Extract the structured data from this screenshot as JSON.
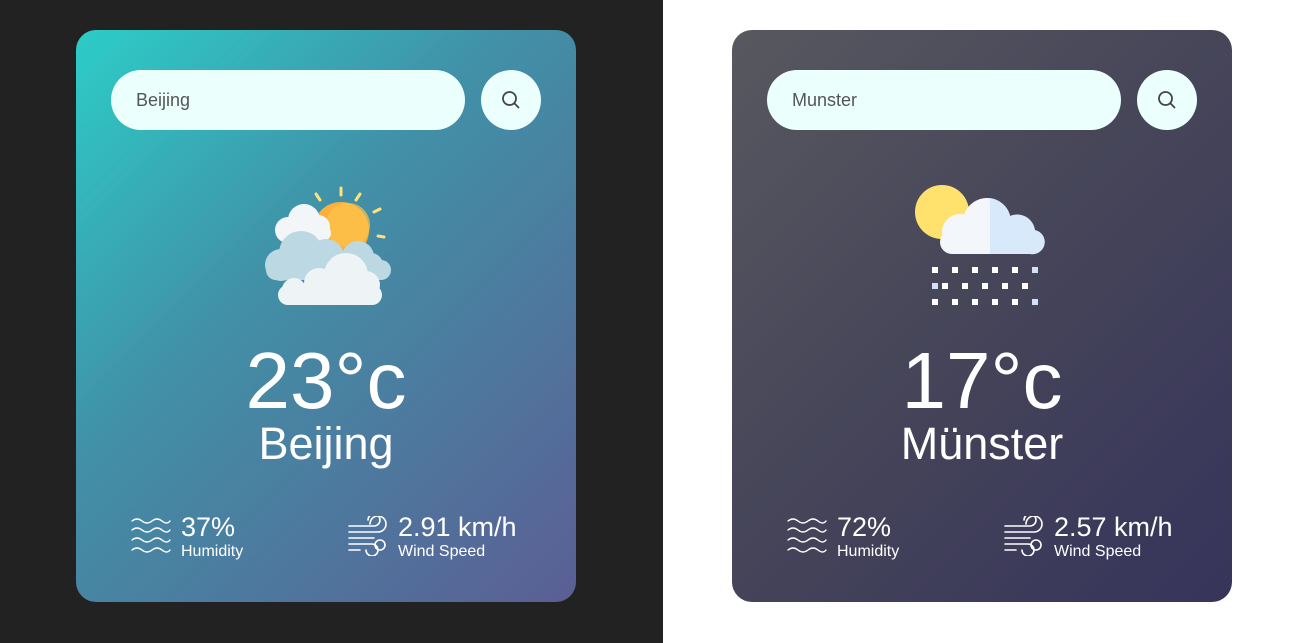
{
  "cards": [
    {
      "search": {
        "value": "Beijing"
      },
      "weather_icon": "partly-cloudy-sun-icon",
      "temperature": "23°c",
      "city": "Beijing",
      "humidity": {
        "value": "37%",
        "label": "Humidity"
      },
      "wind": {
        "value": "2.91 km/h",
        "label": "Wind Speed"
      }
    },
    {
      "search": {
        "value": "Munster"
      },
      "weather_icon": "snow-cloud-sun-icon",
      "temperature": "17°c",
      "city": "Münster",
      "humidity": {
        "value": "72%",
        "label": "Humidity"
      },
      "wind": {
        "value": "2.57 km/h",
        "label": "Wind Speed"
      }
    }
  ],
  "colors": {
    "left_background": "#222222",
    "right_background": "#ffffff",
    "card_left_gradient": [
      "#2ccdc7",
      "#5b5e94"
    ],
    "card_right_gradient": [
      "#585860",
      "#36345a"
    ],
    "input_background": "#ebfffc"
  }
}
